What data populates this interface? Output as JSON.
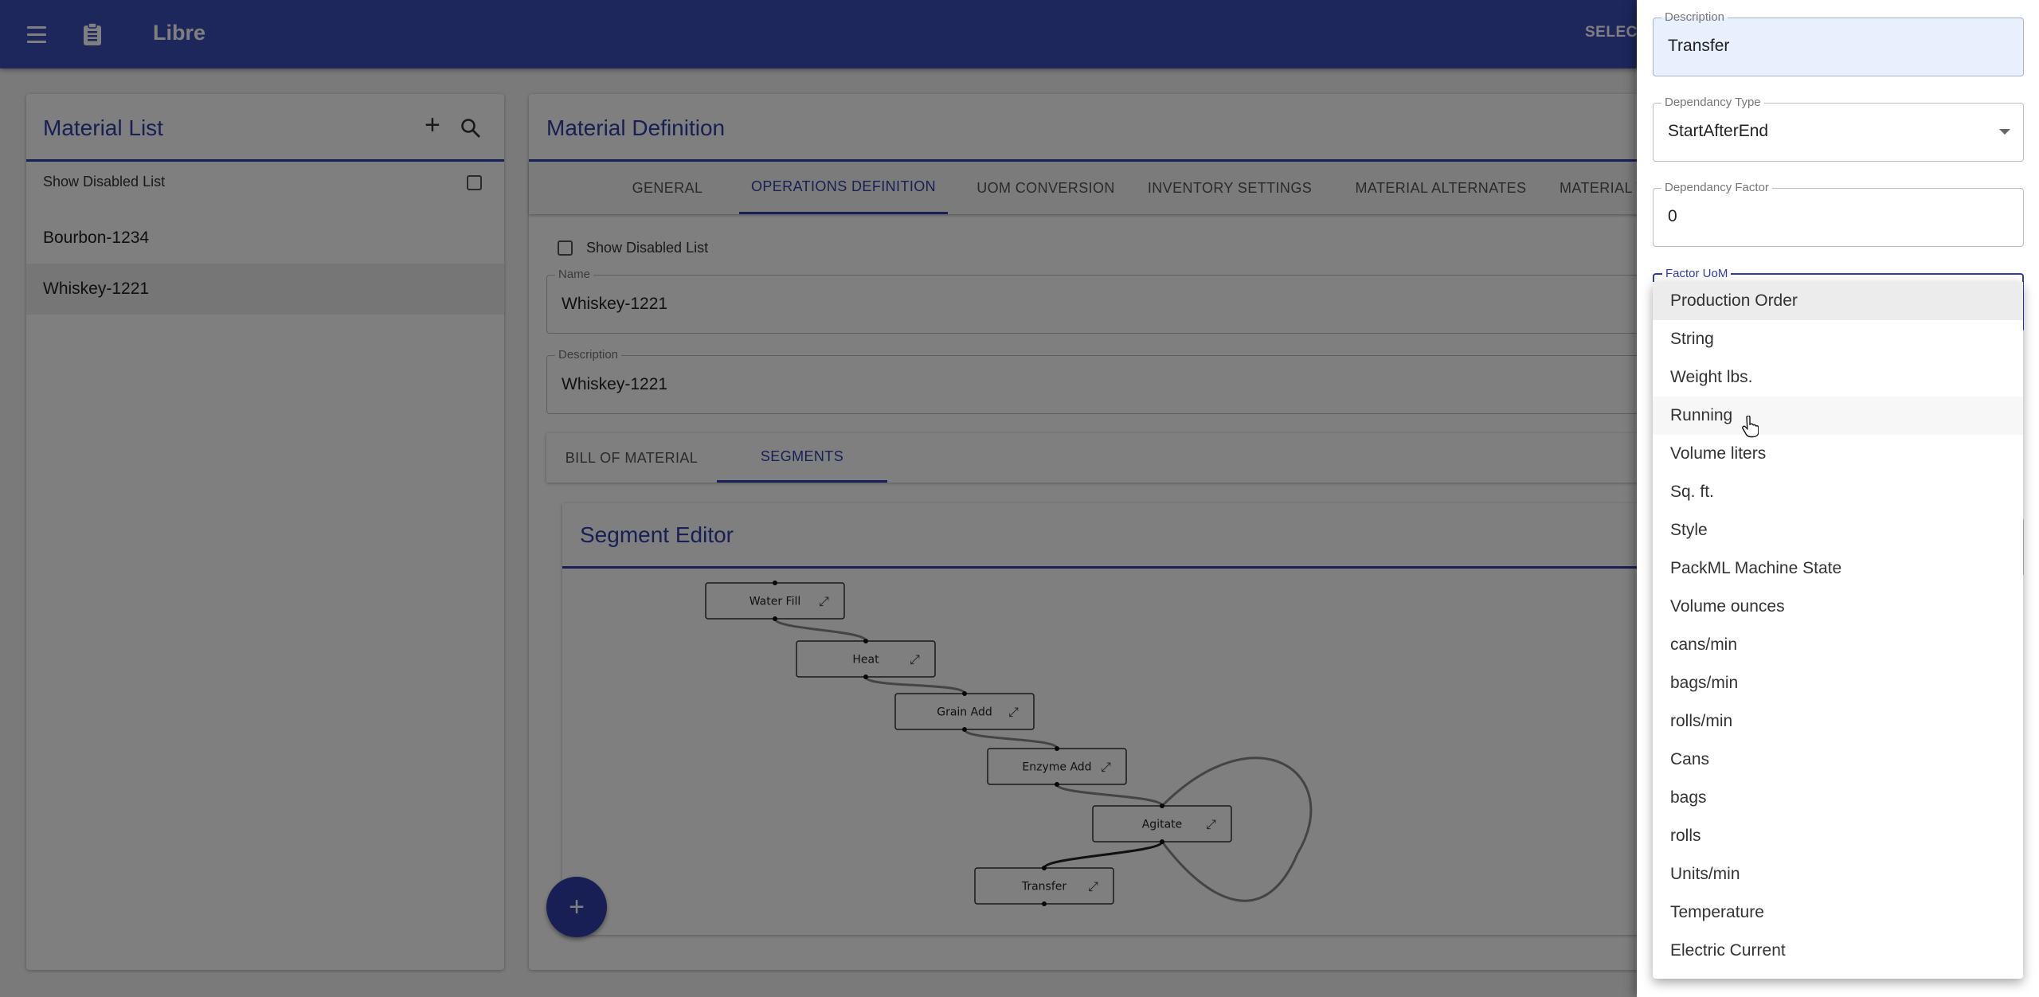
{
  "header": {
    "app_title": "Libre",
    "select_button": "SELECT"
  },
  "material_list": {
    "title": "Material List",
    "show_disabled_label": "Show Disabled List",
    "show_disabled_checked": false,
    "items": [
      {
        "label": "Bourbon-1234",
        "selected": false
      },
      {
        "label": "Whiskey-1221",
        "selected": true
      }
    ]
  },
  "material_definition": {
    "title": "Material Definition",
    "tabs": [
      {
        "label": "GENERAL",
        "active": false
      },
      {
        "label": "OPERATIONS DEFINITION",
        "active": true
      },
      {
        "label": "UOM CONVERSION",
        "active": false
      },
      {
        "label": "INVENTORY SETTINGS",
        "active": false
      },
      {
        "label": "MATERIAL ALTERNATES",
        "active": false
      },
      {
        "label": "MATERIAL TRANS",
        "active": false
      }
    ],
    "show_disabled_label": "Show Disabled List",
    "name_field": {
      "label": "Name",
      "value": "Whiskey-1221"
    },
    "description_field": {
      "label": "Description",
      "value": "Whiskey-1221"
    },
    "sub_tabs": [
      {
        "label": "BILL OF MATERIAL",
        "active": false
      },
      {
        "label": "SEGMENTS",
        "active": true
      }
    ],
    "segment_editor": {
      "title": "Segment Editor",
      "nodes": [
        {
          "label": "Water Fill"
        },
        {
          "label": "Heat"
        },
        {
          "label": "Grain Add"
        },
        {
          "label": "Enzyme Add"
        },
        {
          "label": "Agitate"
        },
        {
          "label": "Transfer"
        }
      ],
      "edges": [
        {
          "from": "Water Fill",
          "to": "Heat"
        },
        {
          "from": "Heat",
          "to": "Grain Add"
        },
        {
          "from": "Grain Add",
          "to": "Enzyme Add"
        },
        {
          "from": "Enzyme Add",
          "to": "Agitate"
        },
        {
          "from": "Agitate",
          "to": "Transfer"
        },
        {
          "from": "Agitate",
          "to": "Agitate"
        }
      ],
      "add_button": "+"
    }
  },
  "drawer": {
    "description": {
      "label": "Description",
      "value": "Transfer"
    },
    "dependancy_type": {
      "label": "Dependancy Type",
      "value": "StartAfterEnd"
    },
    "dependancy_factor": {
      "label": "Dependancy Factor",
      "value": "0"
    },
    "factor_uom": {
      "label": "Factor UoM"
    },
    "factor_uom_options": [
      "Production Order",
      "String",
      "Weight lbs.",
      "Running",
      "Volume liters",
      "Sq. ft.",
      "Style",
      "PackML Machine State",
      "Volume ounces",
      "cans/min",
      "bags/min",
      "rolls/min",
      "Cans",
      "bags",
      "rolls",
      "Units/min",
      "Temperature",
      "Electric Current"
    ],
    "focused_option": "Production Order",
    "hovered_option": "Running"
  },
  "colors": {
    "primary": "#2f3fa8",
    "header": "#3a4fb8",
    "autofill": "#e8f0fe"
  }
}
